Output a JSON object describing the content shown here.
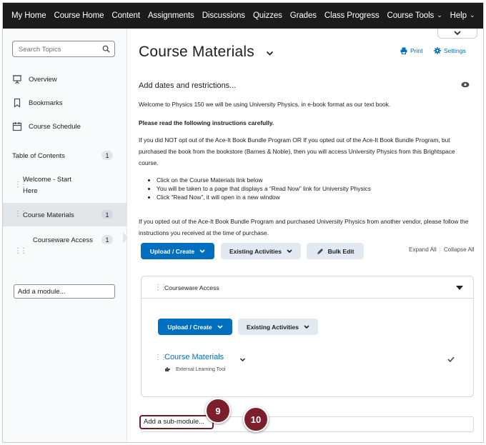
{
  "topnav": {
    "items": [
      {
        "label": "My Home",
        "has_menu": false
      },
      {
        "label": "Course Home",
        "has_menu": false
      },
      {
        "label": "Content",
        "has_menu": false
      },
      {
        "label": "Assignments",
        "has_menu": false
      },
      {
        "label": "Discussions",
        "has_menu": false
      },
      {
        "label": "Quizzes",
        "has_menu": false
      },
      {
        "label": "Grades",
        "has_menu": false
      },
      {
        "label": "Class Progress",
        "has_menu": false
      },
      {
        "label": "Course Tools",
        "has_menu": true
      },
      {
        "label": "Help",
        "has_menu": true
      }
    ]
  },
  "sidebar": {
    "search_placeholder": "Search Topics",
    "links": [
      {
        "label": "Overview",
        "icon": "presentation-icon"
      },
      {
        "label": "Bookmarks",
        "icon": "bookmark-icon"
      },
      {
        "label": "Course Schedule",
        "icon": "calendar-icon"
      }
    ],
    "toc_label": "Table of Contents",
    "toc_count": "1",
    "modules": [
      {
        "label": "Welcome - Start Here",
        "count": ""
      },
      {
        "label": "Course Materials",
        "count": "1"
      },
      {
        "label": "Courseware Access",
        "count": "1"
      }
    ],
    "add_module": "Add a module..."
  },
  "main": {
    "title": "Course Materials",
    "print_label": "Print",
    "settings_label": "Settings",
    "add_dates": "Add dates and restrictions...",
    "paragraphs": {
      "welcome": "Welcome to Physics 150 we will be using University Physics, in e-book format as our text book.",
      "instructions": "Please read the following instructions carefully.",
      "opt": "If you did NOT opt out of the Ace-It Book Bundle Program OR If you opted out of the Ace-It Book Bundle Program, but purchased the book from the bookstore (Barnes & Noble), then you will access University Physics from this Brightspace course.",
      "vendor": "If you opted out of the Ace-It Book Bundle Program and purchased University Physics from another vendor, please follow the instructions you received at the time of purchase."
    },
    "bullets": [
      "Click on the Course Materials link below",
      "You will be taken to a page that displays a “Read Now” link for University Physics",
      "Click “Read Now”, it will open in a new window"
    ],
    "buttons": {
      "upload_create": "Upload / Create",
      "existing_activities": "Existing Activities",
      "bulk_edit": "Bulk Edit"
    },
    "expand_all": "Expand All",
    "collapse_all": "Collapse All",
    "submodule": {
      "title": "Courseware Access",
      "upload_create": "Upload / Create",
      "existing_activities": "Existing Activities",
      "topic_title": "Course Materials",
      "topic_type": "External Learning Tool"
    },
    "add_submodule": "Add a sub-module..."
  },
  "steps": [
    "9",
    "10"
  ],
  "colors": {
    "topnav_bg": "#1b1b1b",
    "primary": "#006fbf",
    "secondary_btn": "#e3e9f1",
    "step_marker": "#7a1f2b"
  }
}
